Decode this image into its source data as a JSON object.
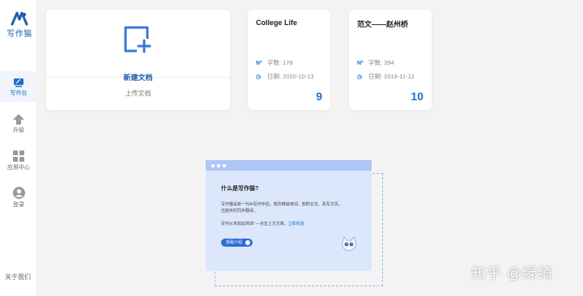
{
  "app": {
    "logo_text": "写作猫"
  },
  "sidebar": {
    "items": [
      {
        "label": "写作台",
        "icon": "desk-icon"
      },
      {
        "label": "升级",
        "icon": "upgrade-arrow-icon"
      },
      {
        "label": "应用中心",
        "icon": "app-grid-icon"
      },
      {
        "label": "登录",
        "icon": "user-icon"
      }
    ],
    "about": "关于我们"
  },
  "new_doc": {
    "label": "新建文档",
    "upload": "上传文档"
  },
  "documents": [
    {
      "title": "College Life",
      "word_label": "字数: 178",
      "date_label": "日期: 2020-10-13",
      "count": "9"
    },
    {
      "title": "范文——赵州桥",
      "word_label": "字数: 394",
      "date_label": "日期: 2019-11-12",
      "count": "10"
    }
  ],
  "intro": {
    "title": "什么是写作猫?",
    "line1": "写作猫是新一代AI写作伴侣，帮你推敲用词、斟酌文法、改写文风，",
    "line2": "还能实时同步翻译。",
    "line3": "写作从未如此简单! —点击上方文章，",
    "link": "立即体验",
    "button": "观看介绍"
  },
  "watermark": "知乎 @绿绮",
  "colors": {
    "accent": "#1f6ec7",
    "intro_bg": "#dce7fc",
    "intro_bar": "#aec7f7"
  }
}
